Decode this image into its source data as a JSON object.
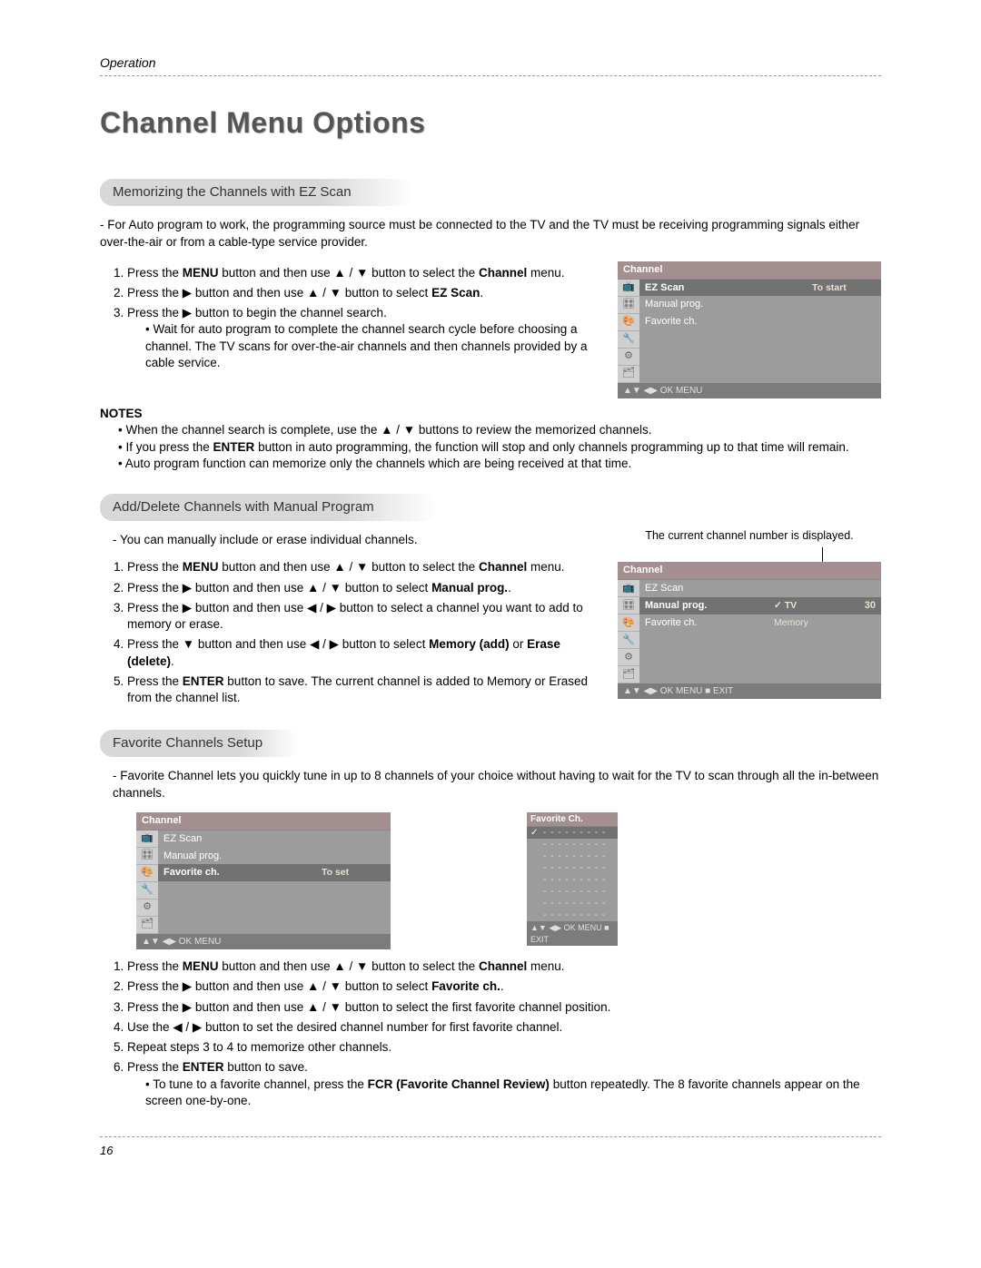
{
  "header": {
    "section": "Operation"
  },
  "title": "Channel Menu Options",
  "sec1": {
    "heading": "Memorizing the Channels with EZ Scan",
    "intro": "- For Auto program to work, the programming source must be connected to the TV and the TV must be receiving programming signals either over-the-air or from a cable-type service provider.",
    "step1_a": "Press the ",
    "step1_b": "MENU",
    "step1_c": " button and then use ▲ / ▼ button to select the ",
    "step1_d": "Channel",
    "step1_e": " menu.",
    "step2_a": "Press the ▶ button and then use ▲ / ▼ button to select ",
    "step2_b": "EZ Scan",
    "step2_c": ".",
    "step3": "Press the ▶ button to begin the channel search.",
    "step3_sub": "Wait for auto program to complete the channel search cycle before choosing a channel. The TV scans for over-the-air channels and then channels provided by a cable service.",
    "notes_label": "NOTES",
    "note1": "When the channel search is complete, use the ▲ / ▼ buttons to review the memorized channels.",
    "note2_a": "If you press the ",
    "note2_b": "ENTER",
    "note2_c": " button in auto programming, the function will stop and only channels programming up to that time will remain.",
    "note3": "Auto program function can memorize only the channels which are being received at that time.",
    "osd": {
      "title": "Channel",
      "rows": [
        {
          "label": "EZ Scan",
          "value": "To start",
          "hl": true
        },
        {
          "label": "Manual prog.",
          "value": ""
        },
        {
          "label": "Favorite ch.",
          "value": ""
        }
      ],
      "footer": "▲▼  ◀▶ OK  MENU"
    }
  },
  "sec2": {
    "heading": "Add/Delete Channels with Manual Program",
    "intro": "-  You can manually include or erase individual channels.",
    "caption": "The current channel number is displayed.",
    "step1_a": "Press the ",
    "step1_b": "MENU",
    "step1_c": " button and then use ▲ / ▼ button to select the ",
    "step1_d": "Channel",
    "step1_e": " menu.",
    "step2_a": "Press the ▶  button and then use ▲ / ▼ button to select ",
    "step2_b": "Manual prog.",
    "step2_c": ".",
    "step3": "Press the ▶ button and then use ◀ / ▶ button to select a channel you want to add to memory or erase.",
    "step4_a": "Press the ▼ button and then use ◀ / ▶ button to select ",
    "step4_b": "Memory (add)",
    "step4_c": " or ",
    "step4_d": "Erase (delete)",
    "step4_e": ".",
    "step5_a": "Press the ",
    "step5_b": "ENTER",
    "step5_c": " button to save. The current channel is added to Memory or Erased from the channel list.",
    "osd": {
      "title": "Channel",
      "rows": [
        {
          "label": "EZ Scan",
          "value": "",
          "extra": ""
        },
        {
          "label": "Manual prog.",
          "value": "✓ TV",
          "extra": "30",
          "hl": true
        },
        {
          "label": "Favorite ch.",
          "value": "Memory",
          "extra": ""
        }
      ],
      "footer": "▲▼  ◀▶ OK  MENU  ■ EXIT"
    }
  },
  "sec3": {
    "heading": "Favorite Channels Setup",
    "intro": "-  Favorite Channel lets you quickly tune in up to 8 channels of your choice without having to wait for the TV to scan through all the in-between channels.",
    "osd": {
      "title": "Channel",
      "rows": [
        {
          "label": "EZ Scan",
          "value": ""
        },
        {
          "label": "Manual prog.",
          "value": ""
        },
        {
          "label": "Favorite ch.",
          "value": "To set",
          "hl": true
        }
      ],
      "footer": "▲▼  ◀▶ OK  MENU"
    },
    "fav": {
      "title": "Favorite Ch.",
      "rows": [
        {
          "check": "✓",
          "dots": "- - - - - - - - -",
          "hl": true
        },
        {
          "check": "",
          "dots": "- - - - - - - - -"
        },
        {
          "check": "",
          "dots": "- - - - - - - - -"
        },
        {
          "check": "",
          "dots": "- - - - - - - - -"
        },
        {
          "check": "",
          "dots": "- - - - - - - - -"
        },
        {
          "check": "",
          "dots": "- - - - - - - - -"
        },
        {
          "check": "",
          "dots": "- - - - - - - - -"
        },
        {
          "check": "",
          "dots": "- - - - - - - - -"
        }
      ],
      "footer": "▲▼  ◀▶ OK  MENU  ■ EXIT"
    },
    "step1_a": "Press the ",
    "step1_b": "MENU",
    "step1_c": " button and then use ▲ / ▼ button to select the ",
    "step1_d": "Channel",
    "step1_e": " menu.",
    "step2_a": "Press the ▶  button and then use ▲ / ▼ button to select ",
    "step2_b": "Favorite ch.",
    "step2_c": ".",
    "step3": "Press the ▶ button and then use ▲ / ▼ button to select the first favorite channel position.",
    "step4": "Use the ◀ / ▶ button to set the desired channel number for first favorite channel.",
    "step5": "Repeat steps 3 to 4 to memorize other channels.",
    "step6_a": "Press the ",
    "step6_b": "ENTER",
    "step6_c": " button to save.",
    "step6_sub_a": "To tune to a favorite channel, press the ",
    "step6_sub_b": "FCR (Favorite Channel Review)",
    "step6_sub_c": " button repeatedly. The 8 favorite channels appear on the screen one-by-one."
  },
  "page_number": "16",
  "icons": [
    "📺",
    "🎛",
    "🎨",
    "🔧",
    "⚙",
    "🗂"
  ]
}
